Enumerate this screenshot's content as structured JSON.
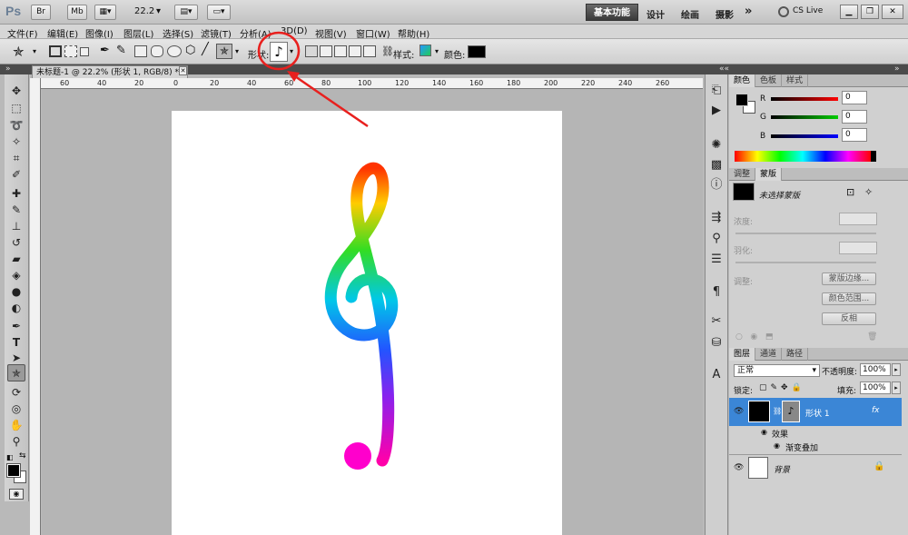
{
  "app": {
    "logo": "Ps",
    "topbar_btns": [
      "Br",
      "Mb"
    ],
    "zoom": "22.2",
    "workspaces": {
      "active": "基本功能",
      "others": [
        "设计",
        "绘画",
        "摄影"
      ],
      "more": "»"
    },
    "cs_live": "CS Live"
  },
  "menu": [
    "文件(F)",
    "编辑(E)",
    "图像(I)",
    "图层(L)",
    "选择(S)",
    "滤镜(T)",
    "分析(A)",
    "3D(D)",
    "视图(V)",
    "窗口(W)",
    "帮助(H)"
  ],
  "options": {
    "shape_label": "形状:",
    "shape_value": "♪",
    "style_label": "样式:",
    "color_label": "颜色:",
    "color": "#000000"
  },
  "document": {
    "tab_title": "未标题-1 @ 22.2% (形状 1, RGB/8) *"
  },
  "ruler": {
    "h_ticks": [
      "60",
      "40",
      "20",
      "0",
      "20",
      "40",
      "60",
      "80",
      "100",
      "120",
      "140",
      "160",
      "180",
      "200",
      "220",
      "240",
      "260"
    ]
  },
  "color_panel": {
    "tabs": [
      "颜色",
      "色板",
      "样式"
    ],
    "channels": [
      {
        "label": "R",
        "value": "0"
      },
      {
        "label": "G",
        "value": "0"
      },
      {
        "label": "B",
        "value": "0"
      }
    ]
  },
  "mask_panel": {
    "tabs": [
      "调整",
      "蒙版"
    ],
    "title": "未选择蒙版",
    "density_label": "浓度:",
    "feather_label": "羽化:",
    "adjust_label": "调整:",
    "buttons": [
      "蒙版边缘...",
      "颜色范围...",
      "反相"
    ]
  },
  "layers_panel": {
    "tabs": [
      "图层",
      "通道",
      "路径"
    ],
    "blend_mode": "正常",
    "opacity_label": "不透明度:",
    "opacity": "100%",
    "lock_label": "锁定:",
    "fill_label": "填充:",
    "fill": "100%",
    "layers": [
      {
        "name": "形状 1",
        "fx": "fx",
        "effects_label": "效果",
        "effect": "渐变叠加"
      },
      {
        "name": "背景"
      }
    ]
  },
  "colors": {
    "accent": "#3b86d6",
    "annotation": "#e8201e"
  }
}
